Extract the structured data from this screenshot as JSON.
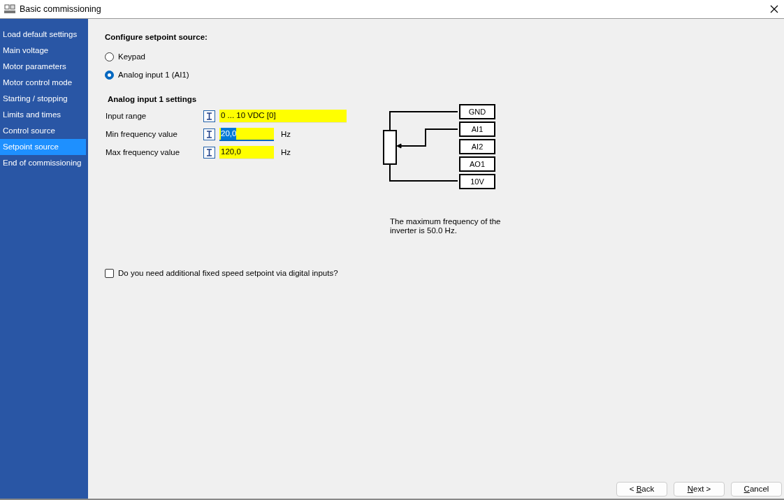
{
  "window": {
    "title": "Basic commissioning"
  },
  "sidebar": {
    "items": [
      {
        "label": "Load default settings",
        "selected": false
      },
      {
        "label": "Main voltage",
        "selected": false
      },
      {
        "label": "Motor parameters",
        "selected": false
      },
      {
        "label": "Motor control mode",
        "selected": false
      },
      {
        "label": "Starting / stopping",
        "selected": false
      },
      {
        "label": "Limits and times",
        "selected": false
      },
      {
        "label": "Control source",
        "selected": false
      },
      {
        "label": "Setpoint source",
        "selected": true
      },
      {
        "label": "End of commissioning",
        "selected": false
      }
    ]
  },
  "setpoint_source": {
    "heading": "Configure setpoint source:",
    "options": [
      {
        "label": "Keypad",
        "selected": false
      },
      {
        "label": "Analog input 1 (AI1)",
        "selected": true
      }
    ]
  },
  "analog_input_settings": {
    "heading": "Analog input 1 settings",
    "fields": [
      {
        "label": "Input range",
        "value": "0 ... 10 VDC [0]",
        "kind": "wide",
        "focused": false
      },
      {
        "label": "Min frequency value",
        "value": "20,0",
        "unit": "Hz",
        "kind": "narrow",
        "focused": true
      },
      {
        "label": "Max frequency value",
        "value": "120,0",
        "unit": "Hz",
        "kind": "narrow",
        "focused": false
      }
    ]
  },
  "diagram": {
    "terminals": [
      "GND",
      "AI1",
      "AI2",
      "AO1",
      "10V"
    ],
    "note": "The maximum frequency of the inverter is 50.0 Hz."
  },
  "fixed_speed_checkbox": {
    "label": "Do you need additional fixed speed setpoint via digital inputs?",
    "checked": false
  },
  "buttons": [
    {
      "before": "< ",
      "access_key": "B",
      "after": "ack"
    },
    {
      "access_key": "N",
      "after": "ext >"
    },
    {
      "access_key": "C",
      "after": "ancel"
    }
  ]
}
